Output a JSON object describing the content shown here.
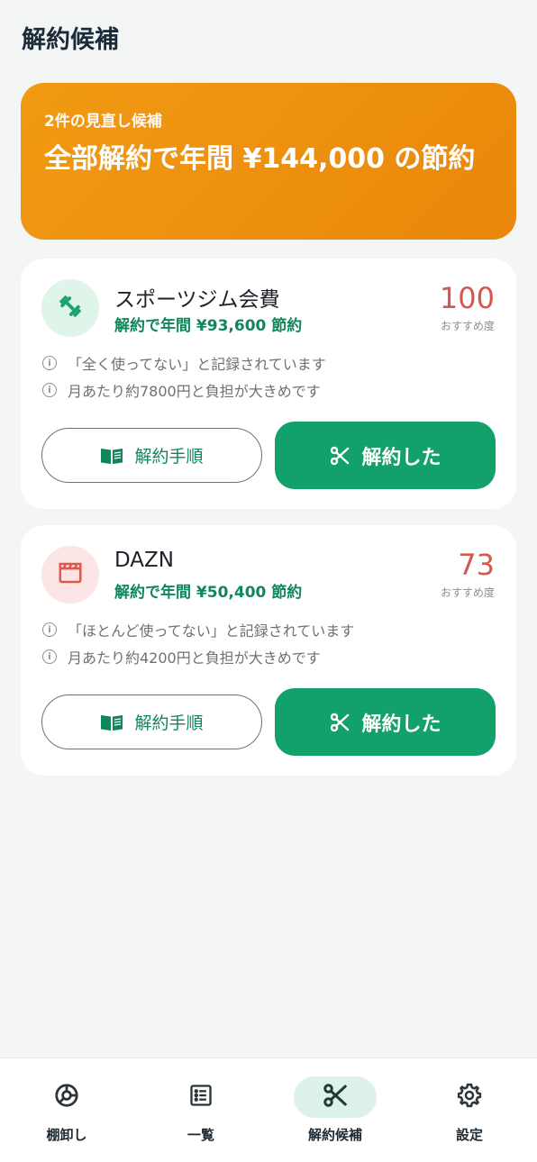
{
  "header": {
    "title": "解約候補"
  },
  "summary": {
    "subtitle": "2件の見直し候補",
    "headline": "全部解約で年間 ¥144,000 の節約"
  },
  "cards": [
    {
      "name": "スポーツジム会費",
      "saving": "解約で年間 ¥93,600 節約",
      "score": "100",
      "score_label": "おすすめ度",
      "reasons": [
        "「全く使ってない」と記録されています",
        "月あたり約7800円と負担が大きめです"
      ],
      "icon": "dumbbell-icon",
      "guide_label": "解約手順",
      "cancel_label": "解約した"
    },
    {
      "name": "DAZN",
      "saving": "解約で年間 ¥50,400 節約",
      "score": "73",
      "score_label": "おすすめ度",
      "reasons": [
        "「ほとんど使ってない」と記録されています",
        "月あたり約4200円と負担が大きめです"
      ],
      "icon": "clapperboard-icon",
      "guide_label": "解約手順",
      "cancel_label": "解約した"
    }
  ],
  "nav": [
    {
      "label": "棚卸し",
      "icon": "donut-chart-icon",
      "active": false
    },
    {
      "label": "一覧",
      "icon": "list-icon",
      "active": false
    },
    {
      "label": "解約候補",
      "icon": "scissors-icon",
      "active": true
    },
    {
      "label": "設定",
      "icon": "gear-icon",
      "active": false
    }
  ],
  "colors": {
    "accent_green": "#12a06b",
    "saving_text": "#10875a",
    "summary_orange": "#f29a14",
    "score_red": "#d6574f"
  }
}
